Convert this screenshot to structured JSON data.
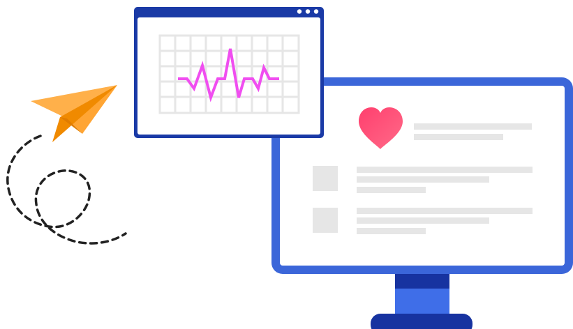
{
  "illustration": {
    "colors": {
      "monitor_frame": "#3b66d9",
      "monitor_stand_dark": "#1733a0",
      "monitor_stand_light": "#3f6ee8",
      "screen_background": "#ffffff",
      "popup_border": "#1a3aa6",
      "popup_titlebar": "#1a3aa6",
      "grid_lines": "#e6e6e6",
      "heartbeat_line": "#f04ef0",
      "heart_gradient_start": "#ff3f6e",
      "heart_gradient_end": "#ff6a88",
      "placeholder_gray": "#e6e6e6",
      "plane_light": "#ffb04a",
      "plane_dark": "#f08a00",
      "dashed_trail": "#222222"
    },
    "icons": {
      "heart": "heart-icon",
      "paper_plane": "paper-plane-icon",
      "window_controls": "window-dots-icon",
      "heartbeat": "heartbeat-line-icon"
    }
  }
}
